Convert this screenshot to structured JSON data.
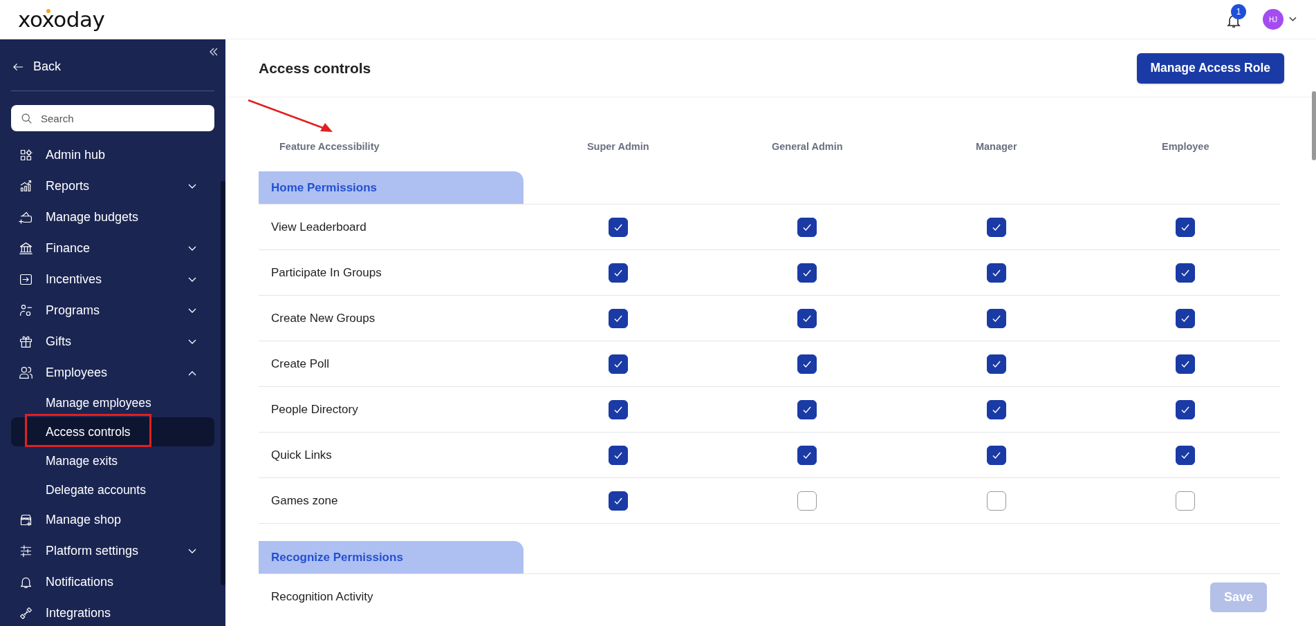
{
  "header": {
    "logo": "xoxoday",
    "notification_count": "1",
    "avatar_initials": "HJ"
  },
  "sidebar": {
    "back": "Back",
    "search": {
      "placeholder": "Search"
    },
    "items": [
      {
        "label": "Admin hub"
      },
      {
        "label": "Reports",
        "expanded": false
      },
      {
        "label": "Manage budgets"
      },
      {
        "label": "Finance",
        "expanded": false
      },
      {
        "label": "Incentives",
        "expanded": false
      },
      {
        "label": "Programs",
        "expanded": false
      },
      {
        "label": "Gifts",
        "expanded": false
      },
      {
        "label": "Employees",
        "expanded": true,
        "children": [
          {
            "label": "Manage employees",
            "selected": false
          },
          {
            "label": "Access controls",
            "selected": true
          },
          {
            "label": "Manage exits",
            "selected": false
          },
          {
            "label": "Delegate accounts",
            "selected": false
          }
        ]
      },
      {
        "label": "Manage shop"
      },
      {
        "label": "Platform settings",
        "expanded": false
      },
      {
        "label": "Notifications"
      },
      {
        "label": "Integrations"
      }
    ]
  },
  "page": {
    "title": "Access controls",
    "action_button": "Manage Access Role",
    "columns": [
      "Feature Accessibility",
      "Super Admin",
      "General Admin",
      "Manager",
      "Employee"
    ],
    "sections": [
      {
        "title": "Home Permissions",
        "rows": [
          {
            "label": "View Leaderboard",
            "checked": [
              true,
              true,
              true,
              true
            ]
          },
          {
            "label": "Participate In Groups",
            "checked": [
              true,
              true,
              true,
              true
            ]
          },
          {
            "label": "Create New Groups",
            "checked": [
              true,
              true,
              true,
              true
            ]
          },
          {
            "label": "Create Poll",
            "checked": [
              true,
              true,
              true,
              true
            ]
          },
          {
            "label": "People Directory",
            "checked": [
              true,
              true,
              true,
              true
            ]
          },
          {
            "label": "Quick Links",
            "checked": [
              true,
              true,
              true,
              true
            ]
          },
          {
            "label": "Games zone",
            "checked": [
              true,
              false,
              false,
              false
            ]
          }
        ]
      },
      {
        "title": "Recognize Permissions",
        "rows": [
          {
            "label": "Recognition Activity",
            "checked": []
          }
        ]
      }
    ],
    "save_button": {
      "label": "Save",
      "disabled": true
    }
  }
}
